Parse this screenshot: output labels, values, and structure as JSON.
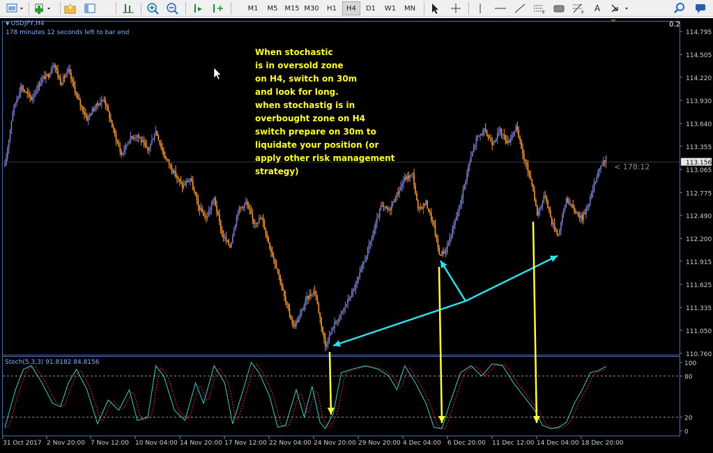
{
  "toolbar": {
    "timeframes": [
      "M1",
      "M5",
      "M15",
      "M30",
      "H1",
      "H4",
      "D1",
      "W1",
      "MN"
    ],
    "active_timeframe": "H4",
    "text_tool_label": "A"
  },
  "chart": {
    "symbol_title": "USDJPY,H4",
    "timer_text": "178 minutes 12 seconds left to bar end",
    "scale_label": "0.2",
    "countdown": "< 178:12",
    "current_price": "113.156",
    "price_ticks": [
      "114.795",
      "114.505",
      "114.220",
      "113.930",
      "113.640",
      "113.355",
      "113.065",
      "112.775",
      "112.490",
      "112.200",
      "111.915",
      "111.625",
      "111.335",
      "111.050",
      "110.760"
    ],
    "date_ticks": [
      "31 Oct 2017",
      "2 Nov 20:00",
      "7 Nov 12:00",
      "10 Nov 04:00",
      "14 Nov 20:00",
      "17 Nov 12:00",
      "22 Nov 04:00",
      "24 Nov 20:00",
      "29 Nov 20:00",
      "4 Dec 04:00",
      "6 Dec 20:00",
      "11 Dec 12:00",
      "14 Dec 04:00",
      "18 Dec 20:00"
    ],
    "annotation": "When stochastic\nis in oversold zone\non H4, switch on 30m\nand look for long.\nwhen stochastig is in\noverbought zone on H4\nswitch prepare on 30m to\nliquidate your position (or\napply other risk management\nstrategy)",
    "colors": {
      "bull": "#7b7fd1",
      "bear": "#ff9a2e",
      "annotation": "#ffff33",
      "arrow_cyan": "#2ee0e8",
      "arrow_yellow": "#ffff33",
      "stoch_main": "#3fd0c8",
      "stoch_signal": "#ff3030"
    }
  },
  "stochastic": {
    "title": "Stoch(5,3,3) 91.8182 84.8156",
    "levels": [
      "100",
      "80",
      "20",
      "0"
    ]
  }
}
